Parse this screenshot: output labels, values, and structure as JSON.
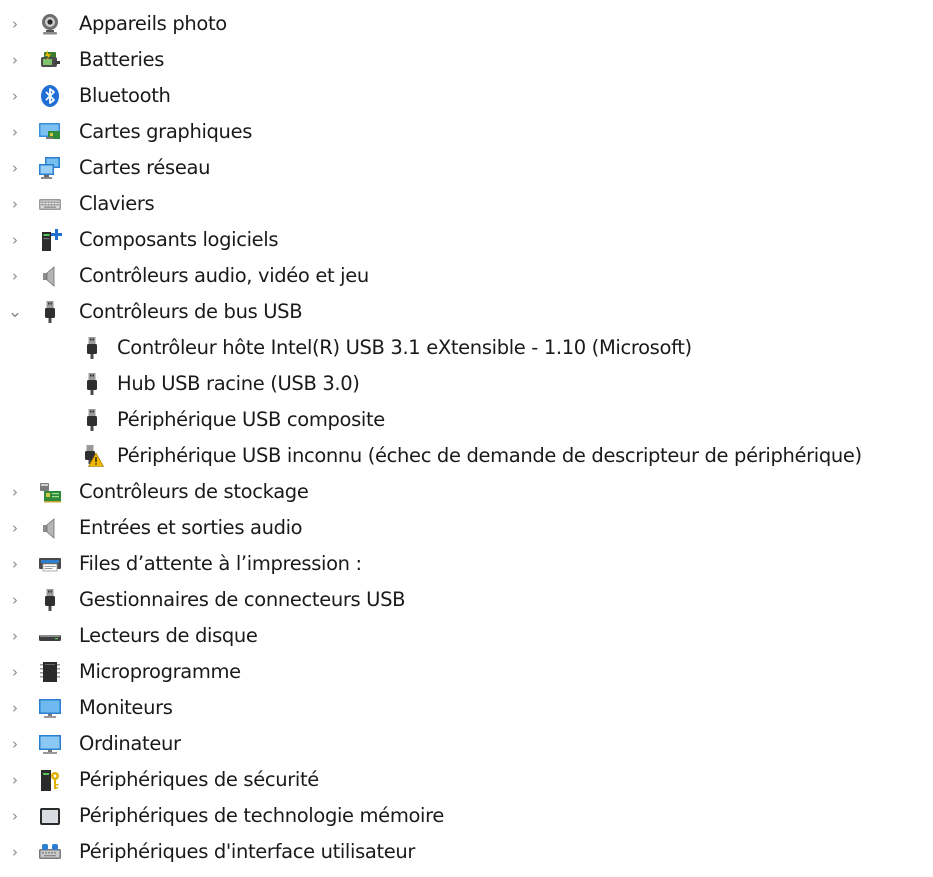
{
  "chevrons": {
    "collapsed": "›",
    "expanded": "⌄"
  },
  "items": [
    {
      "label": "Appareils photo",
      "icon": "webcam-icon",
      "expanded": false
    },
    {
      "label": "Batteries",
      "icon": "battery-icon",
      "expanded": false
    },
    {
      "label": "Bluetooth",
      "icon": "bluetooth-icon",
      "expanded": false
    },
    {
      "label": "Cartes graphiques",
      "icon": "display-adapter-icon",
      "expanded": false
    },
    {
      "label": "Cartes réseau",
      "icon": "network-adapter-icon",
      "expanded": false
    },
    {
      "label": "Claviers",
      "icon": "keyboard-icon",
      "expanded": false
    },
    {
      "label": "Composants logiciels",
      "icon": "software-component-icon",
      "expanded": false
    },
    {
      "label": "Contrôleurs audio, vidéo et jeu",
      "icon": "speaker-icon",
      "expanded": false
    },
    {
      "label": "Contrôleurs de bus USB",
      "icon": "usb-plug-icon",
      "expanded": true,
      "children": [
        {
          "label": "Contrôleur hôte Intel(R) USB 3.1 eXtensible - 1.10 (Microsoft)",
          "icon": "usb-plug-icon"
        },
        {
          "label": "Hub USB racine (USB 3.0)",
          "icon": "usb-plug-icon"
        },
        {
          "label": "Périphérique USB composite",
          "icon": "usb-plug-icon"
        },
        {
          "label": "Périphérique USB inconnu (échec de demande de descripteur de périphérique)",
          "icon": "usb-warning-icon"
        }
      ]
    },
    {
      "label": "Contrôleurs de stockage",
      "icon": "storage-controller-icon",
      "expanded": false
    },
    {
      "label": "Entrées et sorties audio",
      "icon": "speaker-icon",
      "expanded": false
    },
    {
      "label": "Files d’attente à l’impression :",
      "icon": "printer-icon",
      "expanded": false
    },
    {
      "label": "Gestionnaires de connecteurs USB",
      "icon": "usb-plug-icon",
      "expanded": false
    },
    {
      "label": "Lecteurs de disque",
      "icon": "disk-drive-icon",
      "expanded": false
    },
    {
      "label": "Microprogramme",
      "icon": "firmware-chip-icon",
      "expanded": false
    },
    {
      "label": "Moniteurs",
      "icon": "monitor-icon",
      "expanded": false
    },
    {
      "label": "Ordinateur",
      "icon": "computer-icon",
      "expanded": false
    },
    {
      "label": "Périphériques de sécurité",
      "icon": "security-key-icon",
      "expanded": false
    },
    {
      "label": "Périphériques de technologie mémoire",
      "icon": "memory-tech-icon",
      "expanded": false
    },
    {
      "label": "Périphériques d'interface utilisateur",
      "icon": "hid-icon",
      "expanded": false
    }
  ]
}
